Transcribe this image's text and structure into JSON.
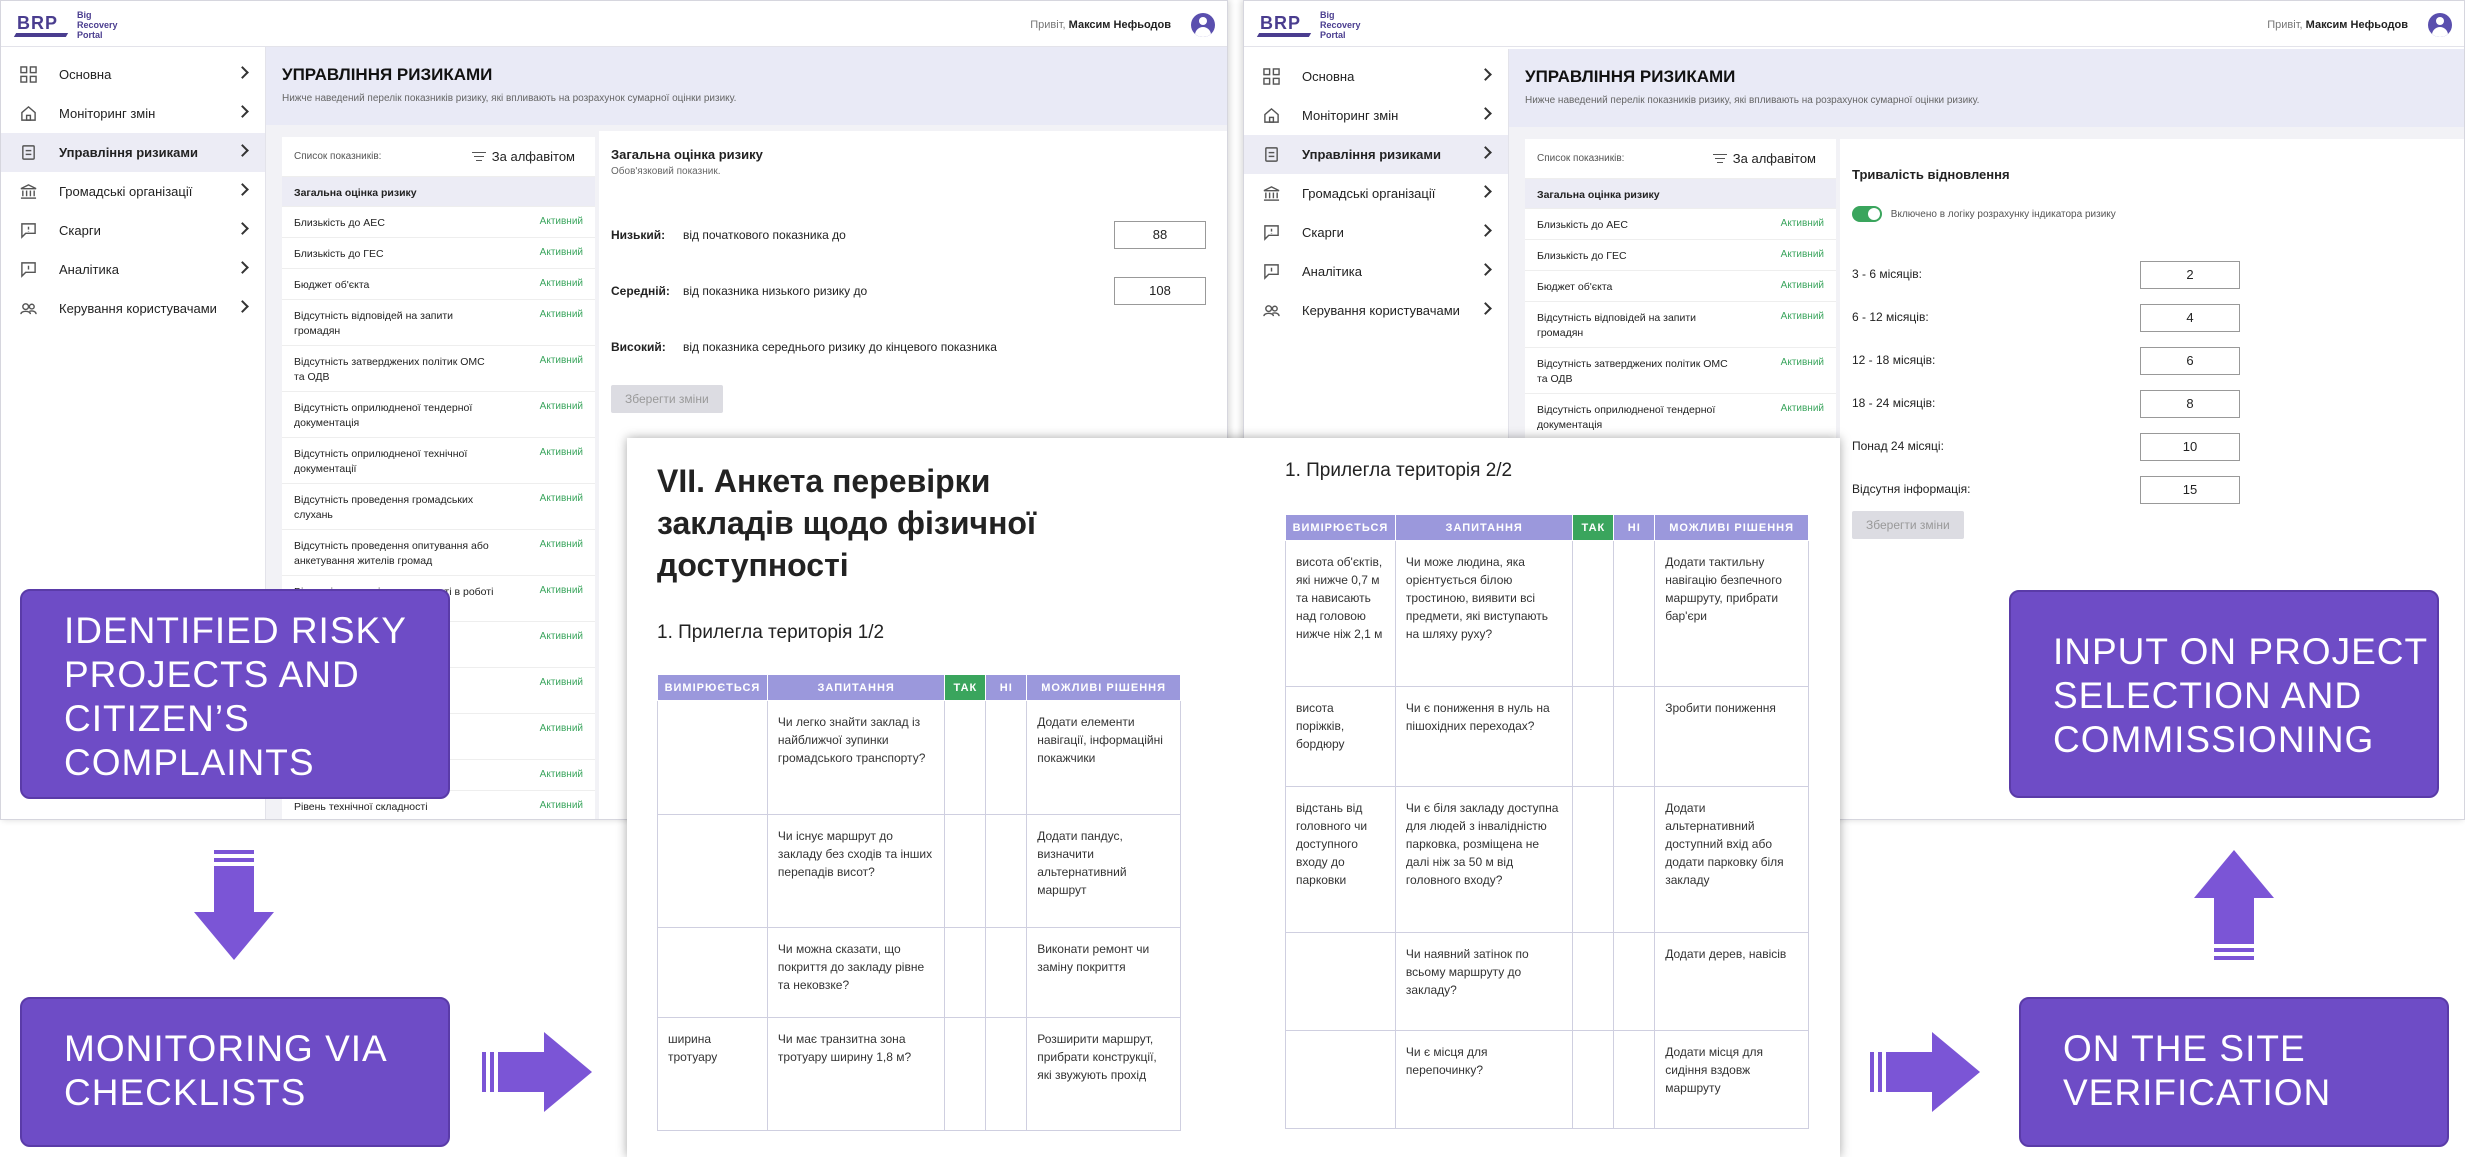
{
  "app": {
    "logo_letters": "BRP",
    "logo_name": [
      "Big",
      "Recovery",
      "Portal"
    ],
    "greeting": "Привіт,",
    "user_name": "Максим Нефьодов"
  },
  "sidebar": {
    "items": [
      {
        "label": "Основна",
        "icon": "grid-icon"
      },
      {
        "label": "Моніторинг змін",
        "icon": "home-icon"
      },
      {
        "label": "Управління ризиками",
        "icon": "clipboard-icon",
        "active": true
      },
      {
        "label": "Громадські організації",
        "icon": "bank-icon"
      },
      {
        "label": "Скарги",
        "icon": "message-alert-icon"
      },
      {
        "label": "Аналітика",
        "icon": "message-icon"
      },
      {
        "label": "Керування користувачами",
        "icon": "users-icon"
      }
    ]
  },
  "page": {
    "title": "УПРАВЛІННЯ РИЗИКАМИ",
    "subtitle": "Нижче наведений перелік показників ризику, які впливають на розрахунок сумарної оцінки ризику."
  },
  "indicator_list": {
    "header": "Список показників:",
    "sort_label": "За алфавітом",
    "status_active": "Активний",
    "rows_left": [
      {
        "name": "Загальна оцінка ризику",
        "status": ""
      },
      {
        "name": "Близькість до АЕС",
        "status": "Активний"
      },
      {
        "name": "Близькість до ГЕС",
        "status": "Активний"
      },
      {
        "name": "Бюджет об'єкта",
        "status": "Активний"
      },
      {
        "name": "Відсутність відповідей на запити громадян",
        "status": "Активний"
      },
      {
        "name": "Відсутність затверджених політик ОМС та ОДВ",
        "status": "Активний"
      },
      {
        "name": "Відсутність оприлюдненої тендерної документація",
        "status": "Активний"
      },
      {
        "name": "Відсутність оприлюдненої технічної документації",
        "status": "Активний"
      },
      {
        "name": "Відсутність проведення громадських слухань",
        "status": "Активний"
      },
      {
        "name": "Відсутність проведення опитування або анкетування жителів громад",
        "status": "Активний"
      },
      {
        "name": "Відсутність участі громадськості в роботі конкурсних комісіях",
        "status": "Активний"
      },
      {
        "name": "",
        "status": "Активний"
      },
      {
        "name": "",
        "status": "Активний"
      },
      {
        "name": "",
        "status": "Активний"
      },
      {
        "name": "",
        "status": "Активний"
      },
      {
        "name": "Рівень технічної складності",
        "status": "Активний"
      }
    ],
    "rows_right": [
      {
        "name": "Загальна оцінка ризику",
        "status": ""
      },
      {
        "name": "Близькість до АЕС",
        "status": "Активний"
      },
      {
        "name": "Близькість до ГЕС",
        "status": "Активний"
      },
      {
        "name": "Бюджет об'єкта",
        "status": "Активний"
      },
      {
        "name": "Відсутність відповідей на запити громадян",
        "status": "Активний"
      },
      {
        "name": "Відсутність затверджених політик ОМС та ОДВ",
        "status": "Активний"
      },
      {
        "name": "Відсутність оприлюдненої тендерної документація",
        "status": "Активний"
      }
    ]
  },
  "risk_detail": {
    "title": "Загальна оцінка ризику",
    "subtitle": "Обов'язковий показник.",
    "low_label": "Низький:",
    "low_text": "від початкового показника до",
    "low_value": "88",
    "mid_label": "Середній:",
    "mid_text": "від показника низького ризику до",
    "mid_value": "108",
    "high_label": "Високий:",
    "high_text": "від показника середнього ризику до кінцевого показника",
    "save_label": "Зберегти зміни"
  },
  "duration_detail": {
    "title": "Тривалість відновлення",
    "toggle_label": "Включено в логіку розрахунку індикатора ризику",
    "rows": [
      {
        "label": "3 - 6 місяців:",
        "value": "2"
      },
      {
        "label": "6 - 12 місяців:",
        "value": "4"
      },
      {
        "label": "12 - 18 місяців:",
        "value": "6"
      },
      {
        "label": "18 - 24 місяців:",
        "value": "8"
      },
      {
        "label": "Понад 24 місяці:",
        "value": "10"
      },
      {
        "label": "Відсутня інформація:",
        "value": "15"
      }
    ],
    "save_label": "Зберегти зміни"
  },
  "document": {
    "title": "VII. Анкета перевірки закладів щодо фізичної доступності",
    "section1_title": "1. Прилегла територія  1/2",
    "section2_title": "1. Прилегла територія  2/2",
    "headers": [
      "ВИМІРЮЄТЬСЯ",
      "ЗАПИТАННЯ",
      "ТАК",
      "НІ",
      "МОЖЛИВІ РІШЕННЯ"
    ],
    "table1": [
      {
        "measure": "",
        "question": "Чи легко знайти заклад із найближчої зупинки громадського транспорту?",
        "solution": "Додати елементи навігації, інформаційні покажчики"
      },
      {
        "measure": "",
        "question": "Чи існує маршрут до закладу без сходів та інших перепадів висот?",
        "solution": "Додати пандус, визначити альтернативний маршрут"
      },
      {
        "measure": "",
        "question": "Чи можна сказати, що покриття до закладу рівне та нековзке?",
        "solution": "Виконати ремонт чи заміну покриття"
      },
      {
        "measure": "ширина тротуару",
        "question": "Чи має транзитна зона тротуару ширину 1,8 м?",
        "solution": "Розширити маршрут, прибрати конструкції, які звужують прохід"
      }
    ],
    "table2": [
      {
        "measure": "висота об'єктів, які нижче 0,7 м та нависають над головою нижче ніж 2,1 м",
        "question": "Чи може людина, яка орієнтується білою тростиною, виявити всі предмети, які виступають на шляху руху?",
        "solution": "Додати тактильну навігацію безпечного маршруту, прибрати бар'єри"
      },
      {
        "measure": "висота поріжків, бордюру",
        "question": "Чи є пониження в нуль на пішохідних переходах?",
        "solution": "Зробити пониження"
      },
      {
        "measure": "відстань від головного чи доступного входу до парковки",
        "question": "Чи є біля закладу доступна для людей з інвалідністю парковка, розміщена не далі ніж за 50 м від головного входу?",
        "solution": "Додати альтернативний доступний вхід або додати парковку біля закладу"
      },
      {
        "measure": "",
        "question": "Чи наявний затінок по всьому маршруту до закладу?",
        "solution": "Додати дерев, навісів"
      },
      {
        "measure": "",
        "question": "Чи є місця для перепочинку?",
        "solution": "Додати місця для сидіння вздовж маршруту"
      }
    ]
  },
  "callouts": {
    "risky": "IDENTIFIED RISKY PROJECTS AND CITIZEN’S COMPLAINTS",
    "monitoring": "MONITORING VIA CHECKLISTS",
    "input": "INPUT ON PROJECT SELECTION AND COMMISSIONING",
    "verification": "ON THE SITE VERIFICATION"
  },
  "colors": {
    "callout": "#6e4cc6",
    "active_status": "#3aa55d",
    "table_header": "#9b98dc",
    "brand": "#4a3d8f"
  }
}
